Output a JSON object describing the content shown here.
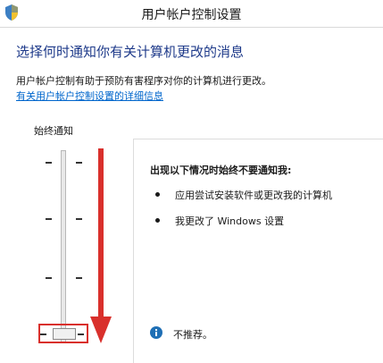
{
  "window": {
    "title": "用户帐户控制设置"
  },
  "main": {
    "heading": "选择何时通知你有关计算机更改的消息",
    "description": "用户帐户控制有助于预防有害程序对你的计算机进行更改。",
    "help_link": "有关用户帐户控制设置的详细信息"
  },
  "slider": {
    "top_label": "始终通知",
    "levels": 4,
    "selected_level": 1
  },
  "panel": {
    "heading": "出现以下情况时始终不要通知我:",
    "bullets": [
      "应用尝试安装软件或更改我的计算机",
      "我更改了 Windows 设置"
    ],
    "recommendation": "不推荐。"
  },
  "colors": {
    "heading": "#1e3a8a",
    "link": "#0066cc",
    "annotation_red": "#d9302c",
    "info_blue": "#1f6fb5"
  },
  "icons": {
    "app": "uac-shield-icon",
    "info": "info-icon",
    "arrow": "down-arrow-icon"
  }
}
